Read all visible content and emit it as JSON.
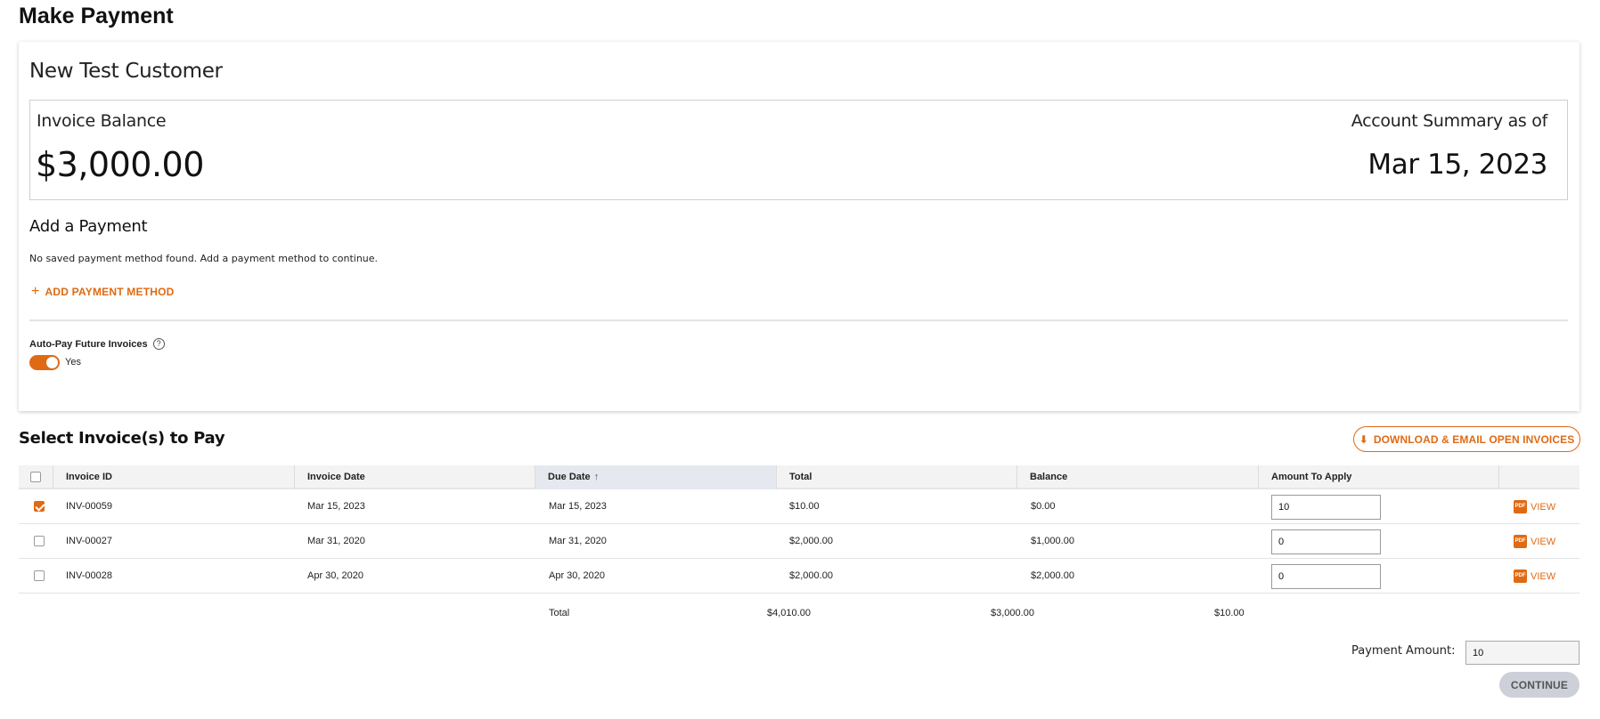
{
  "page": {
    "title": "Make Payment"
  },
  "customer": {
    "name": "New Test Customer"
  },
  "balance": {
    "invoice_label": "Invoice Balance",
    "invoice_value": "$3,000.00",
    "summary_label": "Account Summary as of",
    "summary_date": "Mar 15, 2023"
  },
  "payment": {
    "heading": "Add a Payment",
    "no_method_text": "No saved payment method found. Add a payment method to continue.",
    "add_method_label": "ADD PAYMENT METHOD",
    "autopay_label": "Auto-Pay Future Invoices",
    "autopay_help": "?",
    "autopay_value": "Yes"
  },
  "invoices": {
    "heading": "Select Invoice(s) to Pay",
    "download_label": "DOWNLOAD & EMAIL OPEN INVOICES",
    "columns": [
      "Invoice ID",
      "Invoice Date",
      "Due Date",
      "Total",
      "Balance",
      "Amount To Apply"
    ],
    "sort_indicator": "↑",
    "rows": [
      {
        "id": "INV-00059",
        "invoice_date": "Mar 15, 2023",
        "due_date": "Mar 15, 2023",
        "total": "$10.00",
        "balance": "$0.00",
        "amount": "10",
        "view": "VIEW",
        "pdf": "PDF"
      },
      {
        "id": "INV-00027",
        "invoice_date": "Mar 31, 2020",
        "due_date": "Mar 31, 2020",
        "total": "$2,000.00",
        "balance": "$1,000.00",
        "amount": "0",
        "view": "VIEW",
        "pdf": "PDF"
      },
      {
        "id": "INV-00028",
        "invoice_date": "Apr 30, 2020",
        "due_date": "Apr 30, 2020",
        "total": "$2,000.00",
        "balance": "$2,000.00",
        "amount": "0",
        "view": "VIEW",
        "pdf": "PDF"
      }
    ],
    "row_checked": [
      true,
      false,
      false
    ],
    "totals": {
      "label": "Total",
      "total": "$4,010.00",
      "balance": "$3,000.00",
      "amount": "$10.00"
    }
  },
  "footer": {
    "payment_amount_label": "Payment Amount:",
    "payment_amount_value": "10",
    "continue_label": "CONTINUE"
  },
  "colors": {
    "accent": "#e06a13",
    "disabled_button": "#cdd0d8"
  }
}
